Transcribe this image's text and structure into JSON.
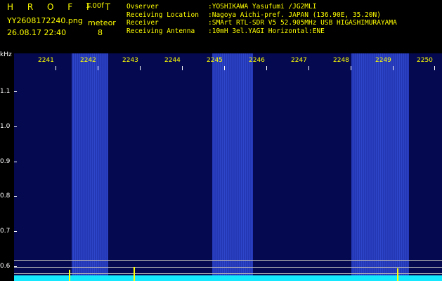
{
  "header": {
    "app_title": "H R O F F T",
    "version": "1.00f",
    "filename": "YY2608172240.png",
    "datetime": "26.08.17 22:40",
    "meteor_label": "meteor",
    "meteor_count": "8"
  },
  "info": [
    {
      "key": "Ovserver",
      "value": ":YOSHIKAWA Yasufumi /JG2MLI"
    },
    {
      "key": "Receiving Location",
      "value": ":Nagoya Aichi-pref. JAPAN (136.90E, 35.20N)"
    },
    {
      "key": "Receiver",
      "value": ":SMArt RTL-SDR V5 52.905MHz USB HIGASHIMURAYAMA"
    },
    {
      "key": "Receiving Antenna",
      "value": ":10mH 3el.YAGI Horizontal:ENE"
    }
  ],
  "plot": {
    "y_unit": "kHz",
    "y_ticks": [
      "1.1",
      "1.0",
      "0.9",
      "0.8",
      "0.7",
      "0.6"
    ],
    "x_ticks": [
      "2241",
      "2242",
      "2243",
      "2244",
      "2245",
      "2246",
      "2247",
      "2248",
      "2249",
      "2250"
    ],
    "colors": {
      "background": "#050a50",
      "band": "#2a40c8",
      "spectrum": "#13e8ff",
      "label": "#ffff00"
    }
  }
}
